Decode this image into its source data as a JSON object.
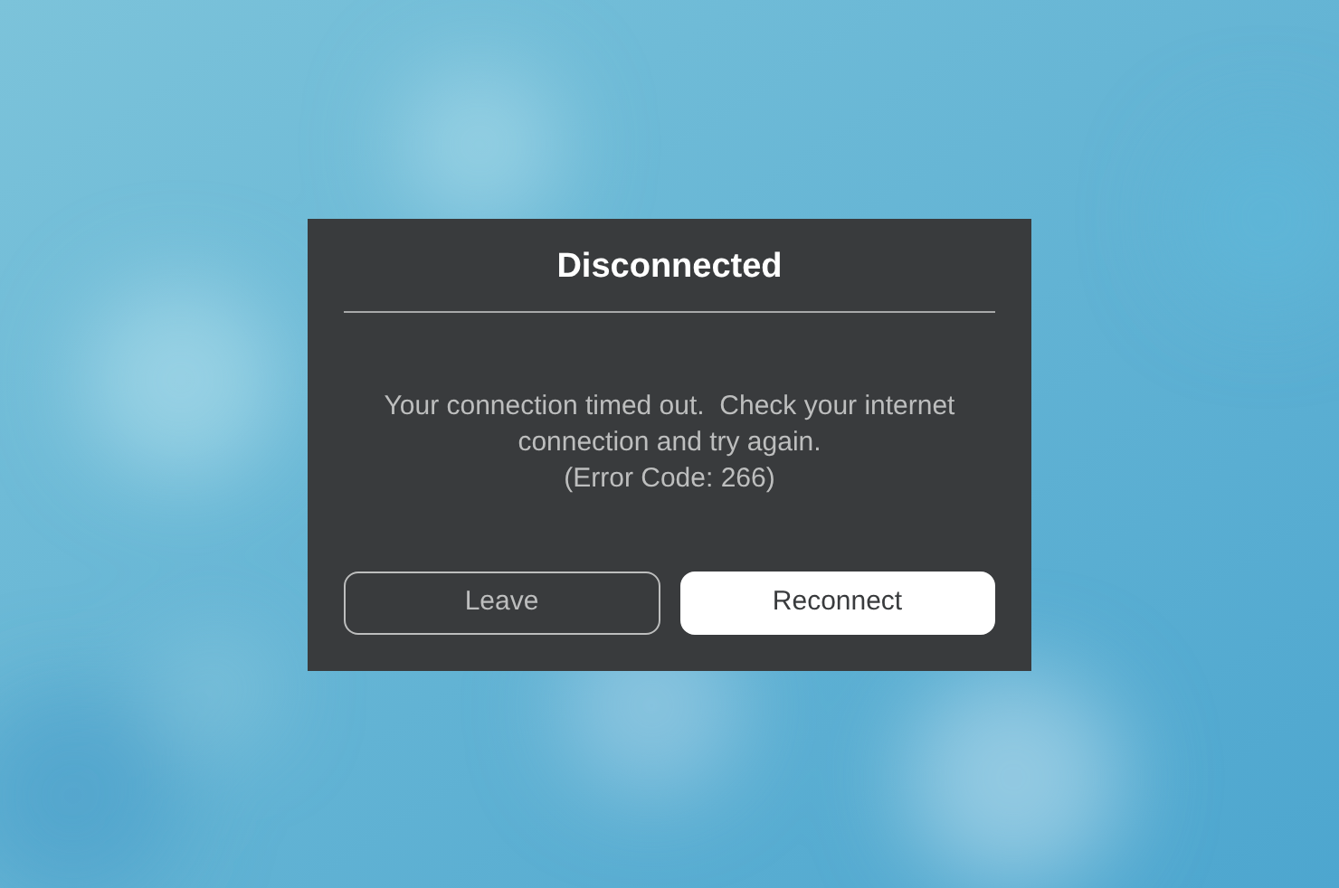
{
  "dialog": {
    "title": "Disconnected",
    "message_lines": [
      "Your connection timed out.  Check your internet",
      "connection and try again.",
      "(Error Code: 266)"
    ],
    "buttons": [
      {
        "label": "Leave",
        "kind": "secondary"
      },
      {
        "label": "Reconnect",
        "kind": "primary"
      }
    ]
  }
}
